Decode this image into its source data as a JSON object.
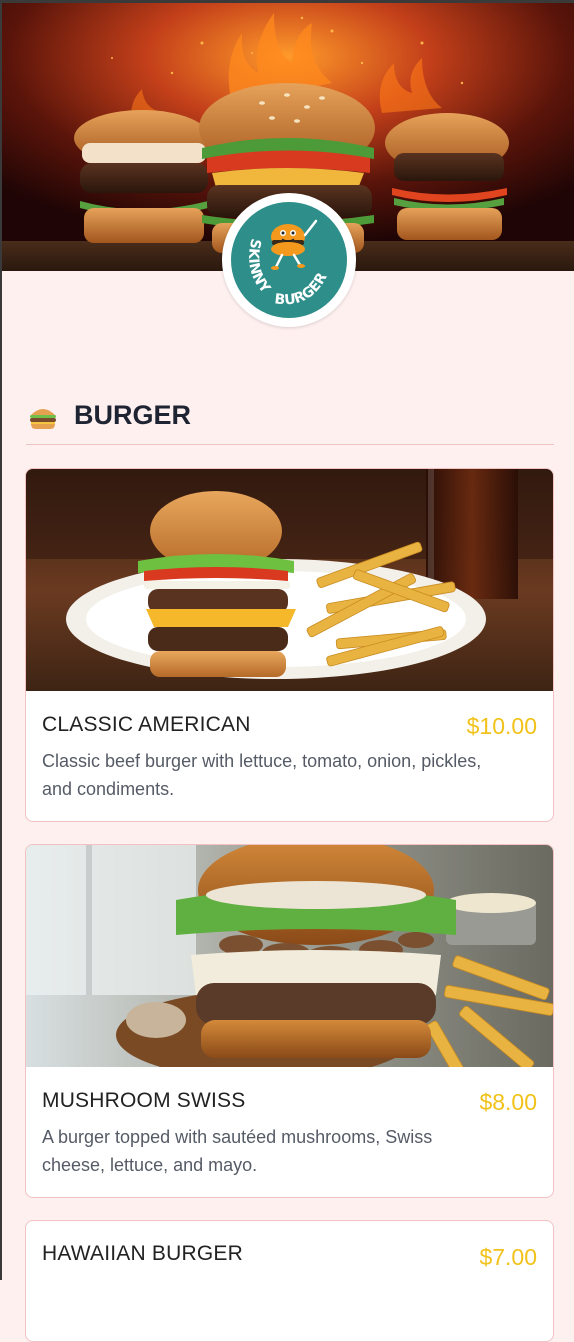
{
  "header": {
    "logo_text": "SKINNY BURGER"
  },
  "section": {
    "title": "BURGER",
    "icon": "burger-icon"
  },
  "menu_items": [
    {
      "name": "CLASSIC AMERICAN",
      "price": "$10.00",
      "description": "Classic beef burger with lettuce, tomato, onion, pickles, and condiments."
    },
    {
      "name": "MUSHROOM SWISS",
      "price": "$8.00",
      "description": "A burger topped with sautéed mushrooms, Swiss cheese, lettuce, and mayo."
    },
    {
      "name": "HAWAIIAN BURGER",
      "price": "$7.00",
      "description": ""
    }
  ],
  "colors": {
    "background": "#fff0f0",
    "price": "#f2c21b",
    "title": "#1f2433",
    "card_border": "#f2c2c2",
    "logo_teal": "#2e8e8a",
    "logo_orange": "#f39a1e"
  }
}
